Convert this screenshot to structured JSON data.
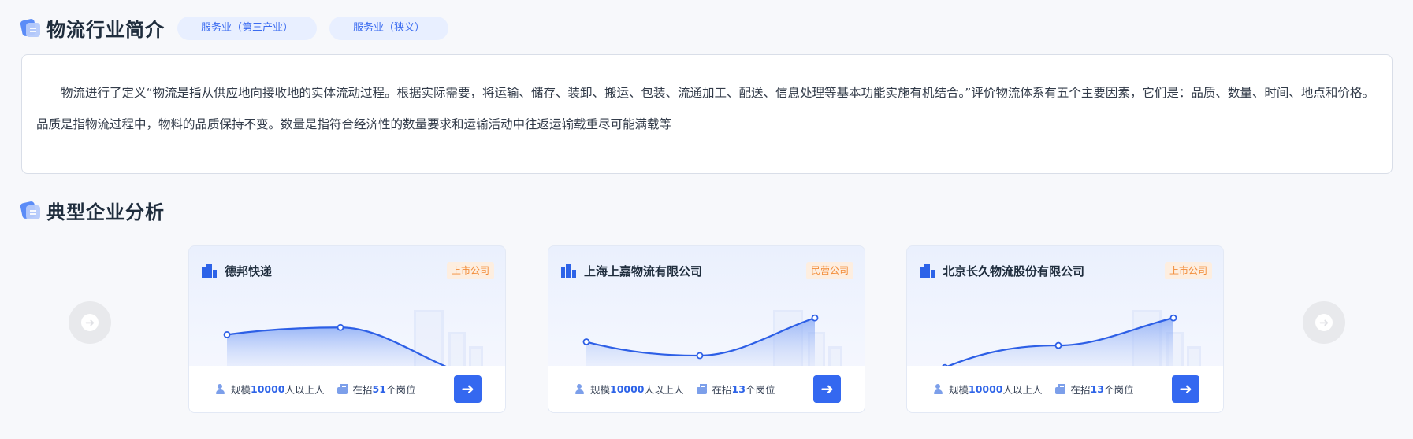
{
  "intro": {
    "title": "物流行业简介",
    "tags": [
      "服务业（第三产业）",
      "服务业（狭义）"
    ],
    "text": "物流进行了定义“物流是指从供应地向接收地的实体流动过程。根据实际需要，将运输、储存、装卸、搬运、包装、流通加工、配送、信息处理等基本功能实施有机结合。”评价物流体系有五个主要因素，它们是：品质、数量、时间、地点和价格。品质是指物流过程中，物料的品质保持不变。数量是指符合经济性的数量要求和运输活动中往返运输载重尽可能满载等"
  },
  "enterprises": {
    "title": "典型企业分析",
    "prev_icon": "arrow-left-icon",
    "next_icon": "arrow-right-icon",
    "cards": [
      {
        "name": "德邦快递",
        "type": "上市公司",
        "scale_prefix": "规模",
        "scale_value": "10000",
        "scale_suffix": "人以上人",
        "jobs_prefix": "在招",
        "jobs_value": "51",
        "jobs_suffix": "个岗位",
        "trend": [
          0.6,
          0.72,
          0.0
        ]
      },
      {
        "name": "上海上嘉物流有限公司",
        "type": "民营公司",
        "scale_prefix": "规模",
        "scale_value": "10000",
        "scale_suffix": "人以上人",
        "jobs_prefix": "在招",
        "jobs_value": "13",
        "jobs_suffix": "个岗位",
        "trend": [
          0.48,
          0.25,
          0.88
        ]
      },
      {
        "name": "北京长久物流股份有限公司",
        "type": "上市公司",
        "scale_prefix": "规模",
        "scale_value": "10000",
        "scale_suffix": "人以上人",
        "jobs_prefix": "在招",
        "jobs_value": "13",
        "jobs_suffix": "个岗位",
        "trend": [
          0.05,
          0.42,
          0.88
        ]
      }
    ]
  },
  "colors": {
    "accent": "#3468f0",
    "tag_bg": "#e8efff",
    "type_text": "#f28c38",
    "type_bg": "#fdeee0"
  }
}
